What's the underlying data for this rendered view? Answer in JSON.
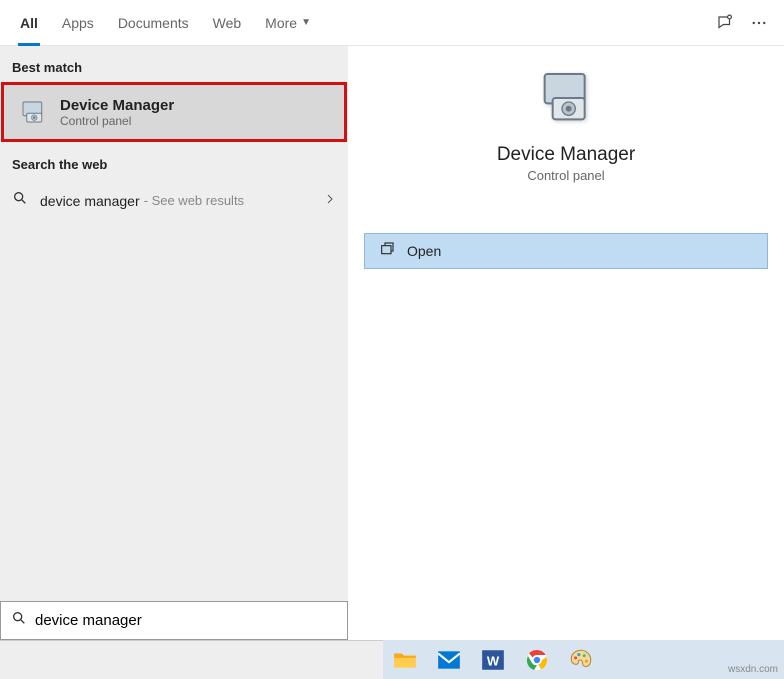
{
  "tabs": {
    "all": "All",
    "apps": "Apps",
    "documents": "Documents",
    "web": "Web",
    "more": "More"
  },
  "sections": {
    "best_match": "Best match",
    "search_web": "Search the web"
  },
  "result": {
    "title": "Device Manager",
    "subtitle": "Control panel"
  },
  "web_result": {
    "query": "device manager",
    "hint": "- See web results"
  },
  "detail": {
    "title": "Device Manager",
    "subtitle": "Control panel",
    "open": "Open"
  },
  "search_input": {
    "value": "device manager"
  },
  "watermark": "wsxdn.com"
}
